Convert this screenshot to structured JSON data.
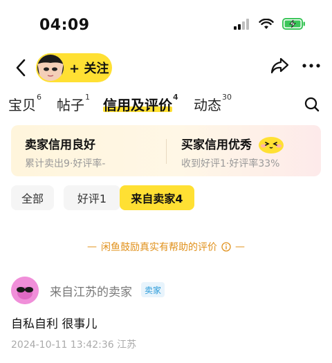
{
  "status_bar": {
    "time": "04:09"
  },
  "nav": {
    "follow_label": "+ 关注"
  },
  "tabs": [
    {
      "label": "宝贝",
      "count": "6"
    },
    {
      "label": "帖子",
      "count": "1"
    },
    {
      "label": "信用及评价",
      "count": "4"
    },
    {
      "label": "动态",
      "count": "30"
    }
  ],
  "credit": {
    "seller_title": "卖家信用良好",
    "seller_sub": "累计卖出9·好评率-",
    "buyer_title": "买家信用优秀",
    "buyer_sub": "收到好评1·好评率33%"
  },
  "filters": [
    {
      "label": "全部"
    },
    {
      "label": "好评1"
    },
    {
      "label": "来自卖家4"
    }
  ],
  "encourage_text": "闲鱼鼓励真实有帮助的评价",
  "review": {
    "reviewer_name": "来自江苏的卖家",
    "role_badge": "卖家",
    "text": "自私自利 很事儿",
    "meta": "2024-10-11 13:42:36 江苏"
  },
  "colors": {
    "accent_yellow": "#ffe033",
    "encourage_orange": "#e0901a",
    "badge_blue": "#2a9ad8"
  },
  "icons": [
    "back-icon",
    "share-icon",
    "more-icon",
    "search-icon",
    "info-icon",
    "signal-icon",
    "wifi-icon",
    "battery-icon"
  ]
}
